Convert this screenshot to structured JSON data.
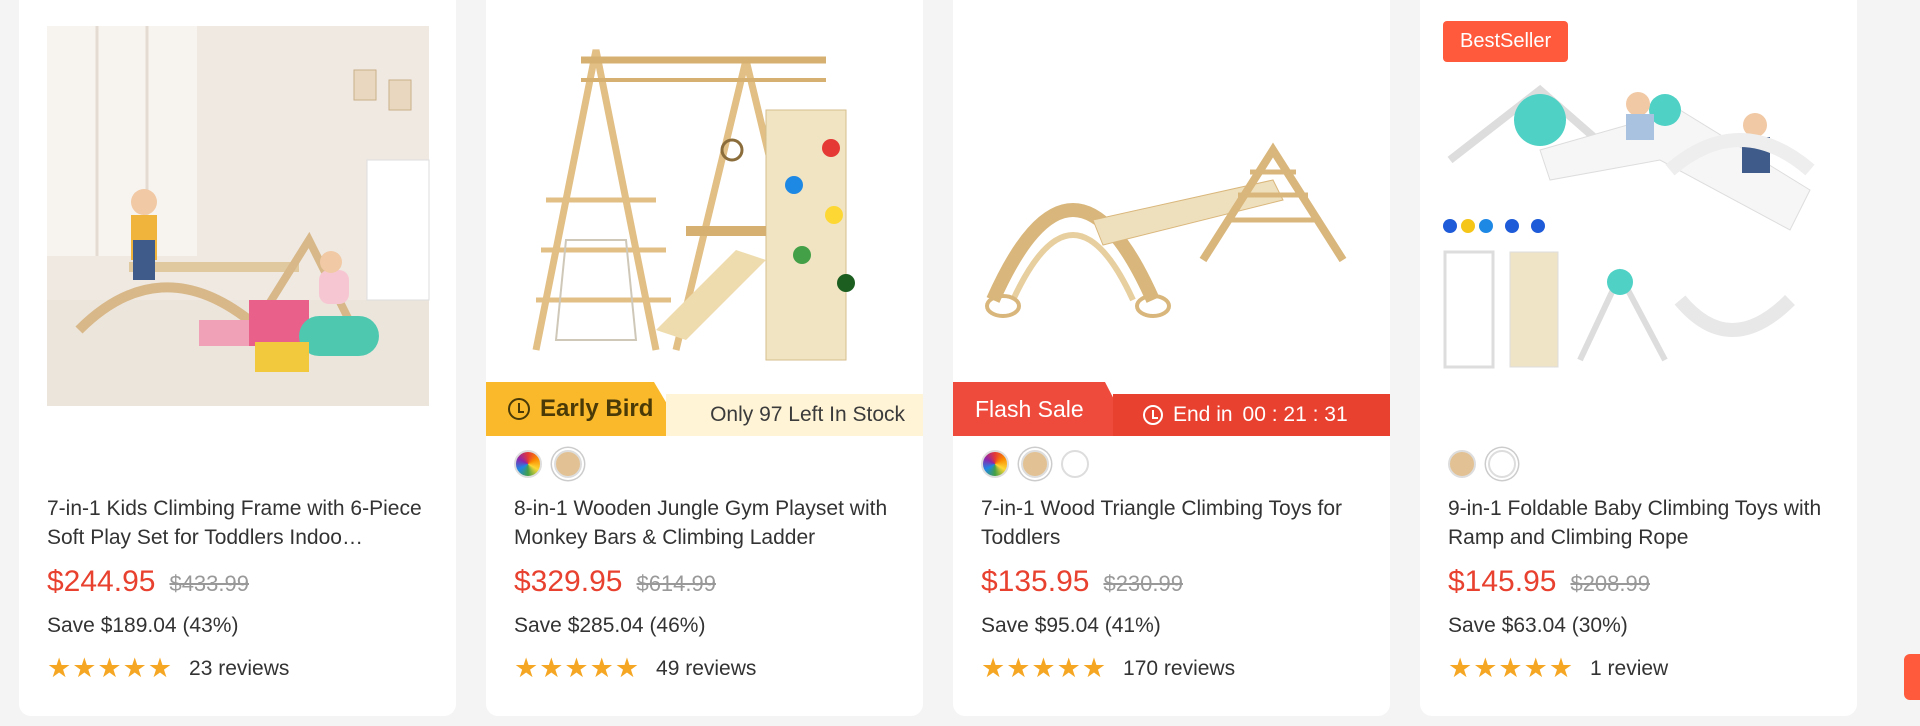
{
  "products": [
    {
      "title": "7-in-1 Kids Climbing Frame with 6-Piece Soft Play Set for Toddlers Indoo…",
      "price": "$244.95",
      "was": "$433.99",
      "save": "Save $189.04 (43%)",
      "stars": "★★★★★",
      "reviews": "23 reviews"
    },
    {
      "title": "8-in-1 Wooden Jungle Gym Playset with Monkey Bars & Climbing Ladder",
      "price": "$329.95",
      "was": "$614.99",
      "save": "Save $285.04 (46%)",
      "stars": "★★★★★",
      "reviews": "49 reviews",
      "promo_label": "Early Bird",
      "stock_text": "Only 97 Left In Stock"
    },
    {
      "title": "7-in-1 Wood Triangle Climbing Toys for Toddlers",
      "price": "$135.95",
      "was": "$230.99",
      "save": "Save $95.04 (41%)",
      "stars": "★★★★★",
      "reviews": "170 reviews",
      "promo_label": "Flash Sale",
      "timer_label": "End in",
      "timer": "00 : 21 : 31"
    },
    {
      "title": "9-in-1 Foldable Baby Climbing Toys with Ramp and Climbing Rope",
      "price": "$145.95",
      "was": "$208.99",
      "save": "Save $63.04 (30%)",
      "stars": "★★★★★",
      "reviews": "1 review",
      "badge": "BestSeller"
    }
  ],
  "colors": {
    "accent": "#e8412f",
    "early_bird": "#f9b92a",
    "star": "#f5a623"
  },
  "icons": [
    "alarm-clock-icon",
    "clock-icon",
    "star-icon"
  ]
}
